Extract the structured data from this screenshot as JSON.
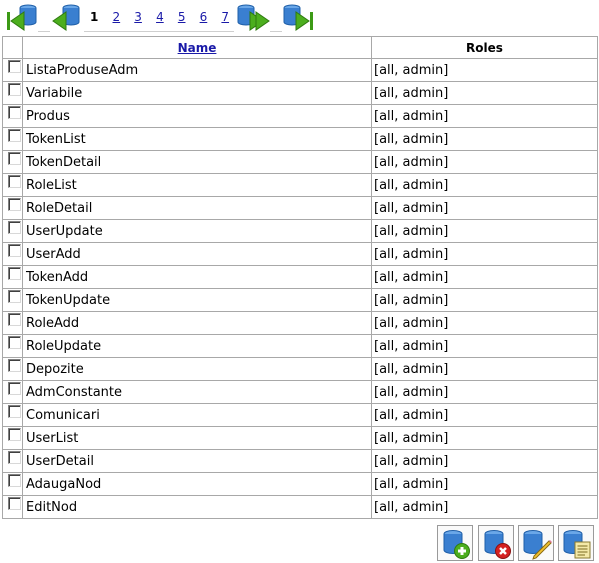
{
  "pager": {
    "nav_icons": [
      "first-page-icon",
      "previous-page-icon",
      "next-page-icon",
      "last-page-icon"
    ],
    "current_page": "1",
    "pages": [
      "1",
      "2",
      "3",
      "4",
      "5",
      "6",
      "7"
    ]
  },
  "table": {
    "columns": {
      "select": "",
      "name": "Name",
      "roles": "Roles"
    },
    "rows": [
      {
        "name": "ListaProduseAdm",
        "roles": "[all, admin]"
      },
      {
        "name": "Variabile",
        "roles": "[all, admin]"
      },
      {
        "name": "Produs",
        "roles": "[all, admin]"
      },
      {
        "name": "TokenList",
        "roles": "[all, admin]"
      },
      {
        "name": "TokenDetail",
        "roles": "[all, admin]"
      },
      {
        "name": "RoleList",
        "roles": "[all, admin]"
      },
      {
        "name": "RoleDetail",
        "roles": "[all, admin]"
      },
      {
        "name": "UserUpdate",
        "roles": "[all, admin]"
      },
      {
        "name": "UserAdd",
        "roles": "[all, admin]"
      },
      {
        "name": "TokenAdd",
        "roles": "[all, admin]"
      },
      {
        "name": "TokenUpdate",
        "roles": "[all, admin]"
      },
      {
        "name": "RoleAdd",
        "roles": "[all, admin]"
      },
      {
        "name": "RoleUpdate",
        "roles": "[all, admin]"
      },
      {
        "name": "Depozite",
        "roles": "[all, admin]"
      },
      {
        "name": "AdmConstante",
        "roles": "[all, admin]"
      },
      {
        "name": "Comunicari",
        "roles": "[all, admin]"
      },
      {
        "name": "UserList",
        "roles": "[all, admin]"
      },
      {
        "name": "UserDetail",
        "roles": "[all, admin]"
      },
      {
        "name": "AdaugaNod",
        "roles": "[all, admin]"
      },
      {
        "name": "EditNod",
        "roles": "[all, admin]"
      }
    ]
  },
  "actions": {
    "icons": [
      "add-record-icon",
      "delete-record-icon",
      "edit-record-icon",
      "view-record-icon"
    ]
  },
  "colors": {
    "link": "#1a1aa8",
    "border": "#a8a8a8",
    "db_blue": "#3a7fd0",
    "arrow_green": "#4cae1e",
    "delete_red": "#d42020"
  }
}
